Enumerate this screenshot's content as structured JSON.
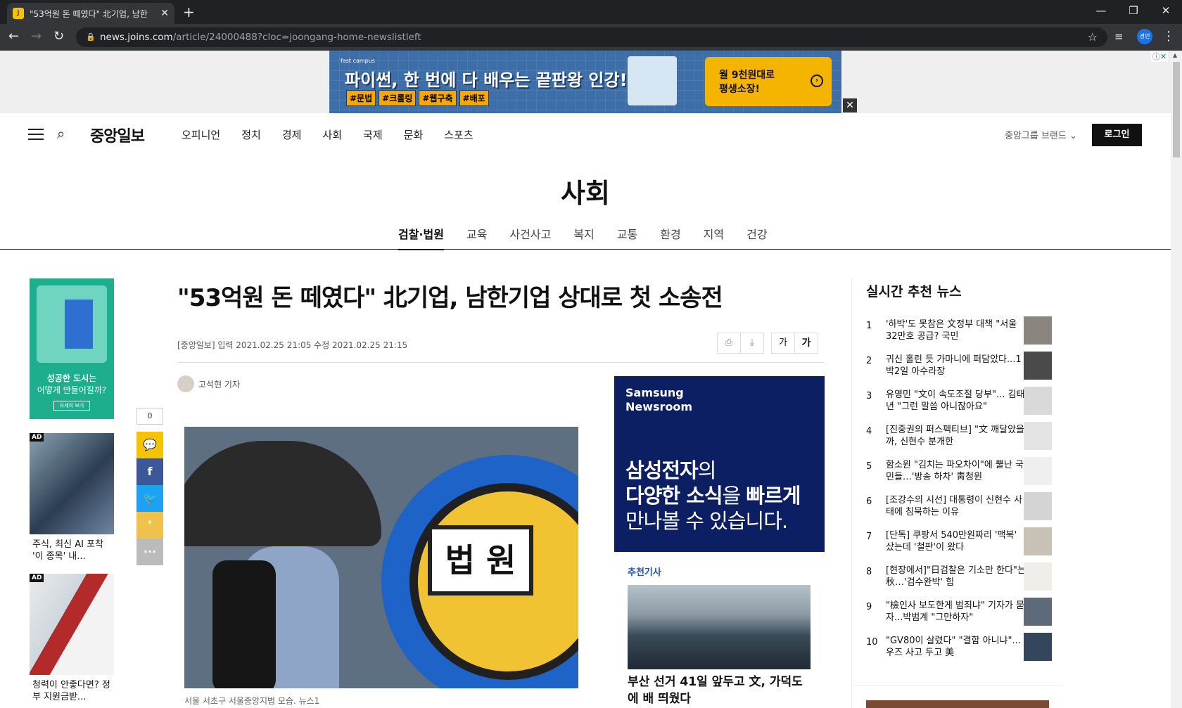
{
  "browser": {
    "tab_title": "\"53억원 돈 떼였다\" 北기업, 남한",
    "tab_favicon": "J",
    "url_host": "news.joins.com",
    "url_path": "/article/24000488?cloc=joongang-home-newslistleft",
    "profile_label": "경민"
  },
  "top_ad": {
    "brand": "fast campus",
    "headline": "파이썬, 한 번에 다 배우는 끝판왕 인강!",
    "tags": [
      "#문법",
      "#크롤링",
      "#웹구축",
      "#배포"
    ],
    "cta_line1": "월 9천원대로",
    "cta_line2": "평생소장!"
  },
  "site": {
    "logo": "중앙일보",
    "menu": [
      "오피니언",
      "정치",
      "경제",
      "사회",
      "국제",
      "문화",
      "스포츠"
    ],
    "group_brand": "중앙그룹 브랜드",
    "login": "로그인"
  },
  "section": {
    "title": "사회",
    "subnav": [
      "검찰·법원",
      "교육",
      "사건사고",
      "복지",
      "교통",
      "환경",
      "지역",
      "건강"
    ],
    "active_index": 0
  },
  "left_ads": {
    "ad1_bold": "성공한 도시",
    "ad1_rest": "는",
    "ad1_line2": "어떻게 만들어질까?",
    "ad1_btn": "자세히 보기",
    "ad2_caption": "주식, 최신 AI 포착 '이 종목' 내...",
    "ad3_caption": "청력이 안좋다면? 정부 지원금받...",
    "ad_badge": "AD"
  },
  "share": {
    "count": "0"
  },
  "article": {
    "title": "\"53억원 돈 떼였다\" 北기업, 남한기업 상대로 첫 소송전",
    "meta": "[중앙일보] 입력 2021.02.25 21:05   수정 2021.02.25 21:15",
    "author": "고석현 기자",
    "photo_sign": "법 원",
    "caption": "서울 서초구 서울중앙지법 모습. 뉴스1",
    "font_small": "가",
    "font_big": "가"
  },
  "side_ad": {
    "brand": "Samsung\nNewsroom",
    "line1_bold": "삼성전자",
    "line1_rest": "의",
    "line2_bold": "다양한 소식",
    "line2_mid": "을 ",
    "line2_end": "빠르게",
    "line3": "만나볼 수 있습니다."
  },
  "recommend": {
    "label": "추천기사",
    "title": "부산 선거 41일 앞두고 文, 가덕도에 배 띄웠다"
  },
  "realtime": {
    "title": "실시간 추천 뉴스",
    "items": [
      {
        "num": "1",
        "text": "'하박'도 못참은 文정부 대책 \"서울 32만호 공급? 국민"
      },
      {
        "num": "2",
        "text": "귀신 홀린 듯 가마니에 퍼담았다...1박2일 아수라장"
      },
      {
        "num": "3",
        "text": "유영민 \"文이 속도조절 당부\"... 김태년 \"그런 말씀 아니잖아요\""
      },
      {
        "num": "4",
        "text": "[진중권의 퍼스펙티브] \"文 깨달았을까, 신현수 분개한"
      },
      {
        "num": "5",
        "text": "함소원 \"김치는 파오차이\"에 뿔난 국민들…'방송 하차' 靑청원"
      },
      {
        "num": "6",
        "text": "[조강수의 시선] 대통령이 신현수 사태에 침묵하는 이유"
      },
      {
        "num": "7",
        "text": "[단독] 쿠팡서 540만원짜리 '맥북' 샀는데 '철판'이 왔다"
      },
      {
        "num": "8",
        "text": "[현장에서]\"日검찰은 기소만 한다\"는 秋…'검수완박' 힘"
      },
      {
        "num": "9",
        "text": "\"檢인사 보도한게 범죄냐\" 기자가 묻자...박범계 \"그만하자\""
      },
      {
        "num": "10",
        "text": "\"GV80이 살렸다\" \"결함 아니냐\"...우즈 사고 두고 美"
      }
    ]
  },
  "colors": {
    "accent": "#1a55b3",
    "samsung_bg": "#0b1f62",
    "kakao": "#f5c400",
    "facebook": "#3b5998",
    "twitter": "#1da1f2"
  }
}
